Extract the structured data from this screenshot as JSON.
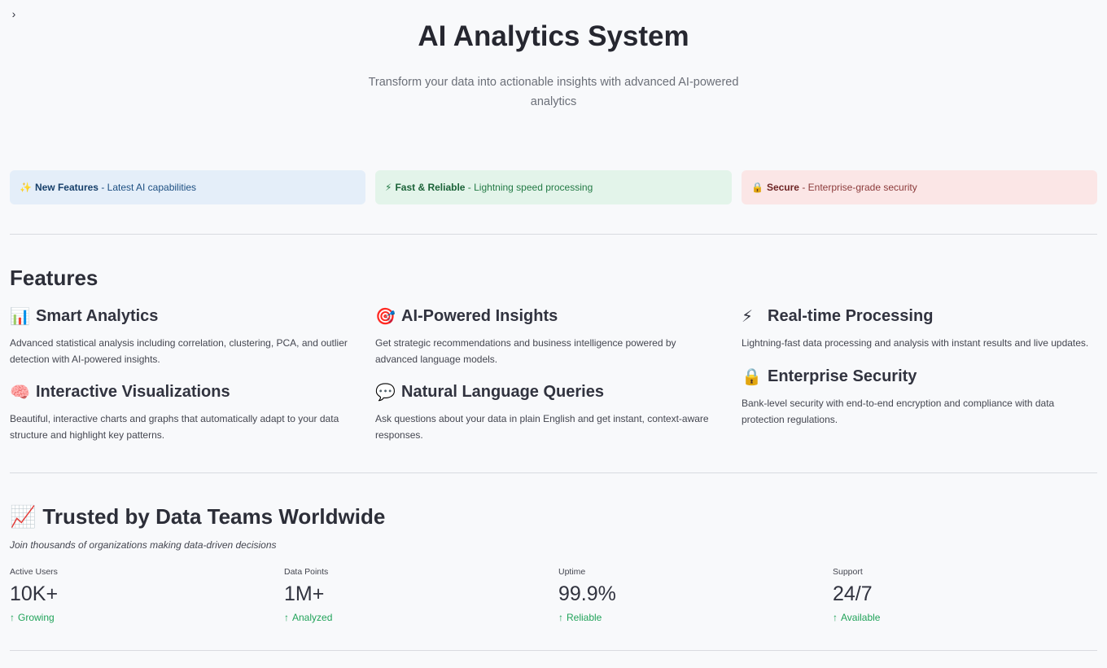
{
  "sidebar": {
    "toggle_glyph": "›"
  },
  "hero": {
    "title": "AI Analytics System",
    "subtitle": "Transform your data into actionable insights with advanced AI-powered analytics"
  },
  "banners": [
    {
      "icon": "sparkles-icon",
      "emoji": "✨",
      "title": "New Features",
      "text": " - Latest AI capabilities",
      "bg": "#e4eef9"
    },
    {
      "icon": "lightning-icon",
      "emoji": "⚡",
      "title": "Fast & Reliable",
      "text": " - Lightning speed processing",
      "bg": "#e3f4ea"
    },
    {
      "icon": "lock-icon",
      "emoji": "🔒",
      "title": "Secure",
      "text": " - Enterprise-grade security",
      "bg": "#fbe6e6"
    }
  ],
  "features": {
    "title": "Features",
    "items": [
      {
        "icon": "bar-chart-icon",
        "emoji": "📊",
        "title": "Smart Analytics",
        "desc": "Advanced statistical analysis including correlation, clustering, PCA, and outlier detection with AI-powered insights."
      },
      {
        "icon": "target-icon",
        "emoji": "🎯",
        "title": "AI-Powered Insights",
        "desc": "Get strategic recommendations and business intelligence powered by advanced language models."
      },
      {
        "icon": "lightning-icon",
        "emoji": "⚡",
        "title": "Real-time Processing",
        "desc": "Lightning-fast data processing and analysis with instant results and live updates."
      },
      {
        "icon": "brain-icon",
        "emoji": "🧠",
        "title": "Interactive Visualizations",
        "desc": "Beautiful, interactive charts and graphs that automatically adapt to your data structure and highlight key patterns."
      },
      {
        "icon": "speech-bubble-icon",
        "emoji": "💬",
        "title": "Natural Language Queries",
        "desc": "Ask questions about your data in plain English and get instant, context-aware responses."
      },
      {
        "icon": "lock-icon",
        "emoji": "🔒",
        "title": "Enterprise Security",
        "desc": "Bank-level security with end-to-end encryption and compliance with data protection regulations."
      }
    ]
  },
  "trusted": {
    "icon": "chart-increasing-icon",
    "emoji": "📈",
    "title": "Trusted by Data Teams Worldwide",
    "caption": "Join thousands of organizations making data-driven decisions",
    "metrics": [
      {
        "label": "Active Users",
        "value": "10K+",
        "delta": "Growing"
      },
      {
        "label": "Data Points",
        "value": "1M+",
        "delta": "Analyzed"
      },
      {
        "label": "Uptime",
        "value": "99.9%",
        "delta": "Reliable"
      },
      {
        "label": "Support",
        "value": "24/7",
        "delta": "Available"
      }
    ],
    "delta_arrow": "↑",
    "delta_color": "#21a35a"
  }
}
